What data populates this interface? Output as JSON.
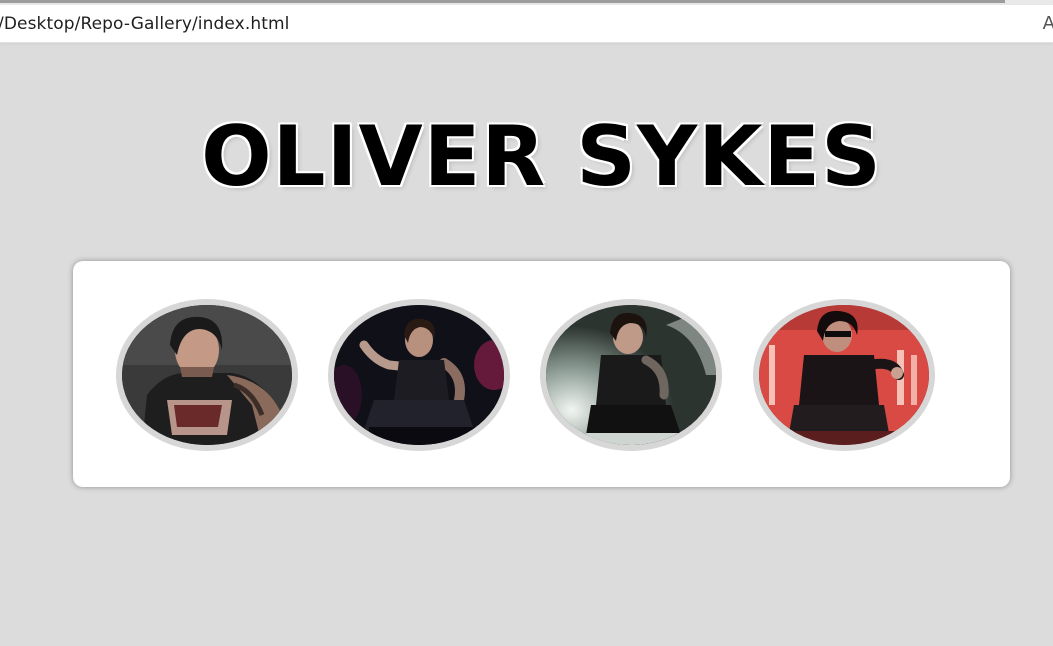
{
  "browser": {
    "url": "/Desktop/Repo-Gallery/index.html",
    "reader_glyph": "A"
  },
  "page": {
    "title": "OLIVER SYKES"
  },
  "gallery": {
    "images": [
      {
        "name": "portrait-tattooed-tank-top",
        "dominant_color": "#2c2c2c"
      },
      {
        "name": "crouching-on-stage-microphone",
        "dominant_color": "#141414"
      },
      {
        "name": "crouching-spotlight-stage",
        "dominant_color": "#5e6a66"
      },
      {
        "name": "crouching-red-lights-stage",
        "dominant_color": "#e0524a"
      }
    ]
  }
}
